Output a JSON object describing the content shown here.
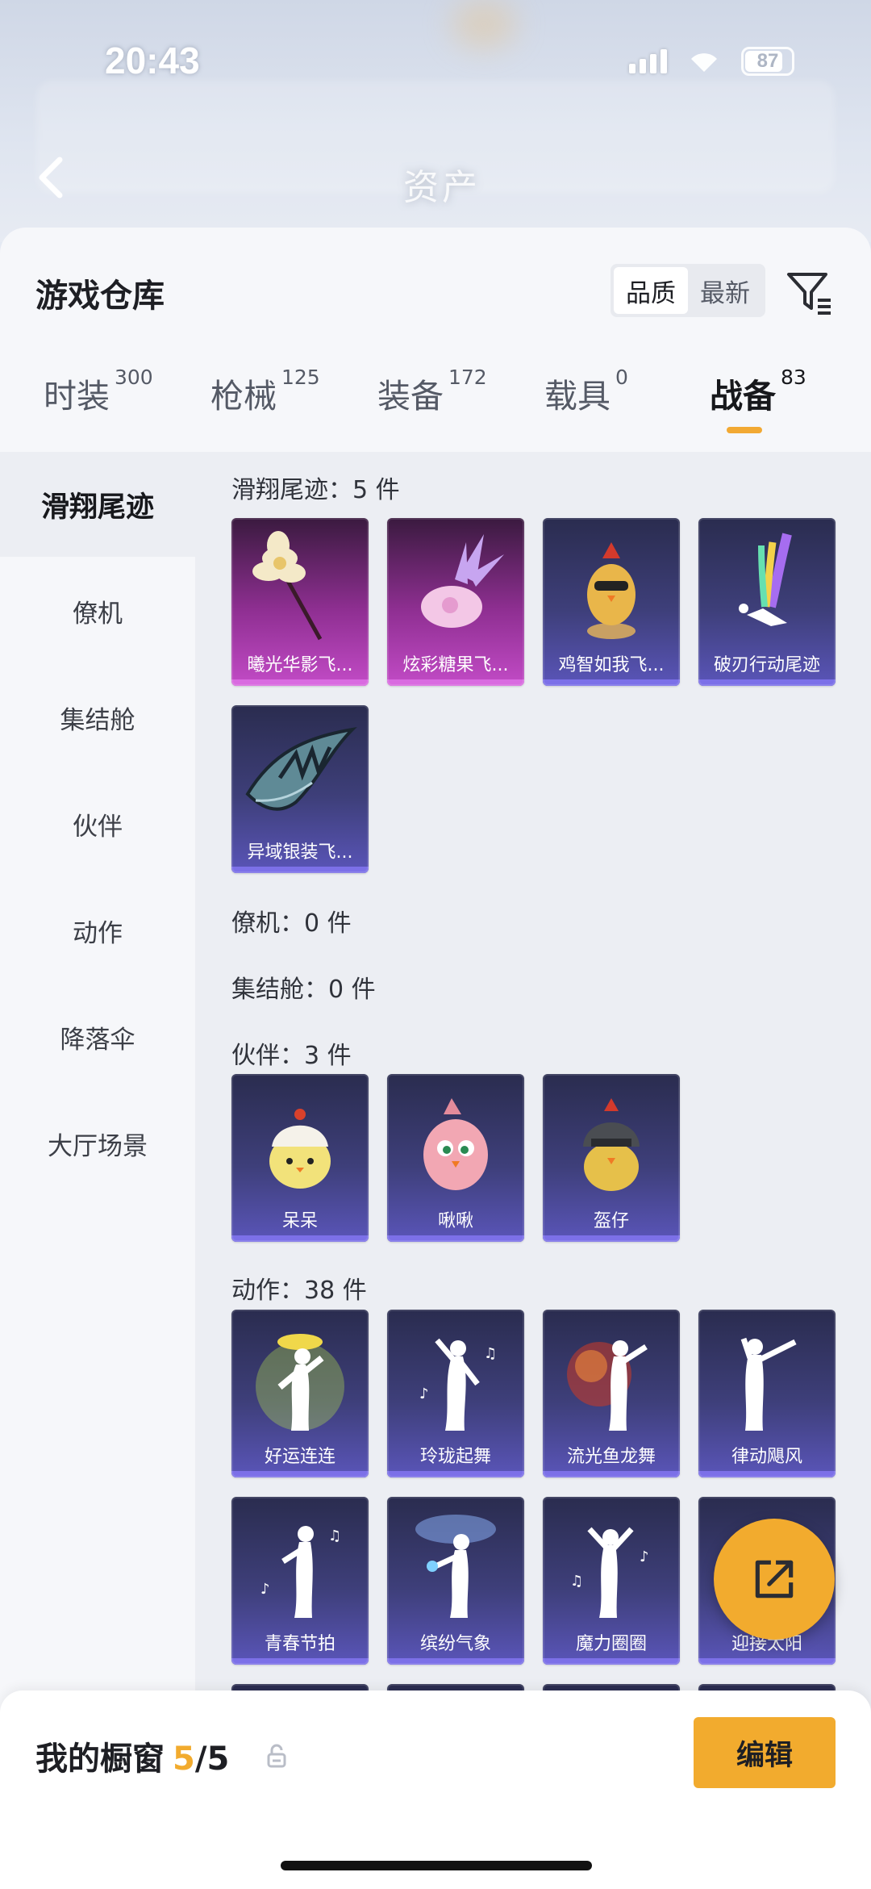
{
  "status_bar": {
    "time": "20:43",
    "battery": "87"
  },
  "nav": {
    "title": "资产"
  },
  "sheet": {
    "title": "游戏仓库",
    "sort_options": [
      "品质",
      "最新"
    ],
    "sort_selected": "品质"
  },
  "tabs": [
    {
      "label": "时装",
      "count": "300"
    },
    {
      "label": "枪械",
      "count": "125"
    },
    {
      "label": "装备",
      "count": "172"
    },
    {
      "label": "载具",
      "count": "0"
    },
    {
      "label": "战备",
      "count": "83",
      "active": true
    }
  ],
  "sidebar": {
    "items": [
      "滑翔尾迹",
      "僚机",
      "集结舱",
      "伙伴",
      "动作",
      "降落伞",
      "大厅场景"
    ],
    "active": "滑翔尾迹"
  },
  "sections": {
    "glide": {
      "title": "滑翔尾迹：5 件",
      "items": [
        "曦光华影飞...",
        "炫彩糖果飞...",
        "鸡智如我飞...",
        "破刃行动尾迹",
        "异域银装飞..."
      ]
    },
    "wingman": {
      "title": "僚机：0 件"
    },
    "rally": {
      "title": "集结舱：0 件"
    },
    "partner": {
      "title": "伙伴：3 件",
      "items": [
        "呆呆",
        "啾啾",
        "盔仔"
      ]
    },
    "emote": {
      "title": "动作：38 件",
      "items": [
        "好运连连",
        "玲珑起舞",
        "流光鱼龙舞",
        "律动飓风",
        "青春节拍",
        "缤纷气象",
        "魔力圈圈",
        "迎接太阳"
      ]
    }
  },
  "bottom": {
    "showcase_label": "我的橱窗",
    "current": "5",
    "total": "/5",
    "edit_label": "编辑"
  },
  "colors": {
    "accent": "#f2ab2e",
    "card_purple": "#3e3f7a",
    "card_pink": "#c24bc6"
  }
}
